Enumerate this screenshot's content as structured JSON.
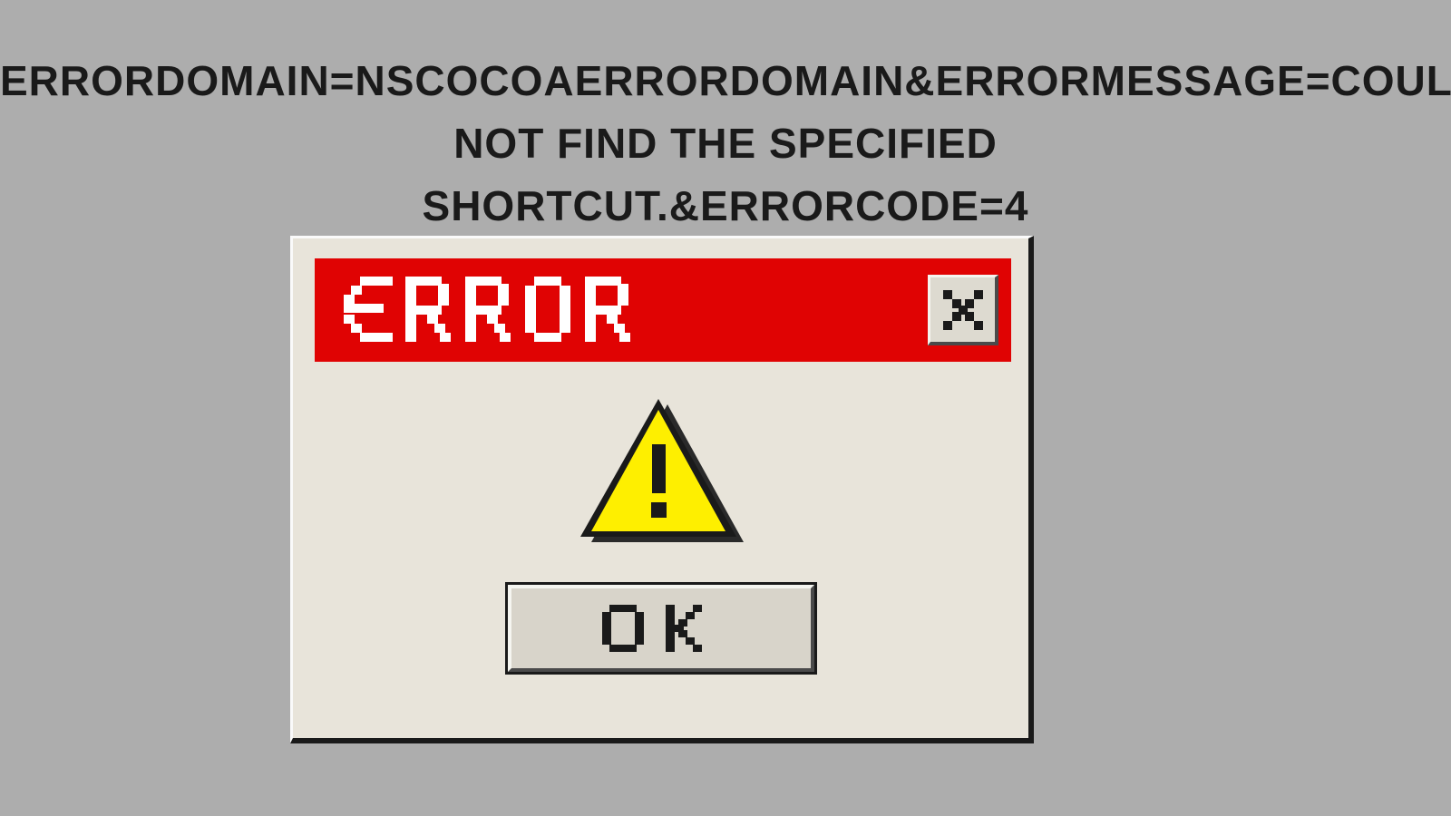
{
  "header": {
    "line1": "errordomain=nscocoaerrordomain&errormessage=could not find the specified",
    "line2": "shortcut.&errorcode=4"
  },
  "dialog": {
    "title": "ERROR",
    "ok_label": "OK"
  },
  "colors": {
    "background": "#adadad",
    "dialog_bg": "#e8e4da",
    "titlebar": "#e00303",
    "warning": "#feef00"
  }
}
